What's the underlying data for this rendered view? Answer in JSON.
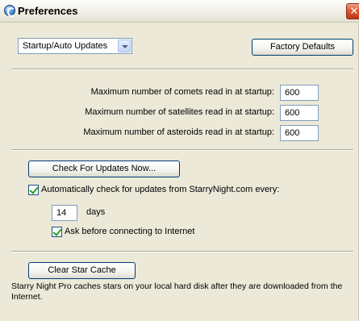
{
  "window": {
    "title": "Preferences",
    "icon": "starry-night-icon",
    "close_glyph": "✕"
  },
  "category_select": {
    "selected": "Startup/Auto Updates"
  },
  "factory_defaults_label": "Factory Defaults",
  "startup_limits": [
    {
      "label": "Maximum number of comets read in at startup:",
      "value": "600"
    },
    {
      "label": "Maximum number of satellites read in at startup:",
      "value": "600"
    },
    {
      "label": "Maximum number of asteroids read in at startup:",
      "value": "600"
    }
  ],
  "updates": {
    "check_now_label": "Check For Updates Now...",
    "auto_check": {
      "label": "Automatically check for updates from StarryNight.com every:",
      "checked": true
    },
    "interval_value": "14",
    "interval_unit": "days",
    "ask_before": {
      "label": "Ask before connecting to Internet",
      "checked": true
    }
  },
  "cache": {
    "clear_label": "Clear Star Cache",
    "description": "Starry Night Pro caches stars on your local hard disk after they are downloaded from the Internet."
  }
}
